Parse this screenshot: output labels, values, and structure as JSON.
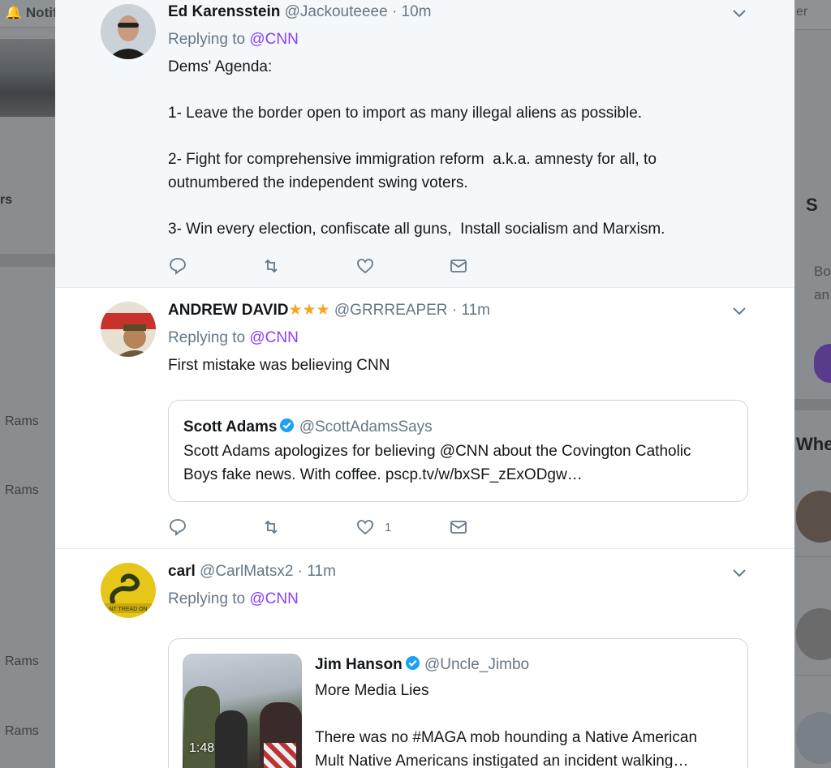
{
  "background": {
    "left_title": "Notifi",
    "left_label": "rs",
    "left_items": [
      "Rams",
      "Rams",
      "Rams",
      "Rams"
    ],
    "right_top": "er",
    "right_heading_1": "S",
    "right_text_1": "Bo",
    "right_text_2": "an",
    "right_heading_2": "Whe"
  },
  "tweets": [
    {
      "name": "Ed Karensstein",
      "handle": "@Jackouteeee",
      "time": "· 10m",
      "reply_prefix": "Replying to",
      "reply_to": "@CNN",
      "text": "Dems' Agenda:\n\n1- Leave the border open to import as many illegal aliens as possible.\n\n2- Fight for comprehensive immigration reform  a.k.a. amnesty for all, to outnumbered the independent swing voters.\n\n3- Win every election, confiscate all guns,  Install socialism and Marxism.",
      "likes": ""
    },
    {
      "name": "ANDREW DAVID",
      "stars": "★★★",
      "handle": "@GRRREAPER",
      "time": "· 11m",
      "reply_prefix": "Replying to",
      "reply_to": "@CNN",
      "text": "First mistake was believing CNN",
      "likes": "1",
      "quote": {
        "name": "Scott Adams",
        "handle": "@ScottAdamsSays",
        "text": "Scott Adams apologizes for believing @CNN about the Covington Catholic\nBoys fake news. With coffee. pscp.tv/w/bxSF_zExODgw…"
      }
    },
    {
      "name": "carl",
      "handle": "@CarlMatsx2",
      "time": "· 11m",
      "reply_prefix": "Replying to",
      "reply_to": "@CNN",
      "quote": {
        "name": "Jim Hanson",
        "handle": "@Uncle_Jimbo",
        "text": "More Media Lies\n\nThere was no #MAGA mob hounding a Native American\nMult Native Americans instigated an incident walking…",
        "video_duration": "1:48"
      }
    }
  ],
  "colors": {
    "mention": "#8a3ffc",
    "secondary_text": "#657786",
    "highlight_bg": "#f5f8fa",
    "verified": "#1da1f2",
    "stars": "#f5a623"
  }
}
